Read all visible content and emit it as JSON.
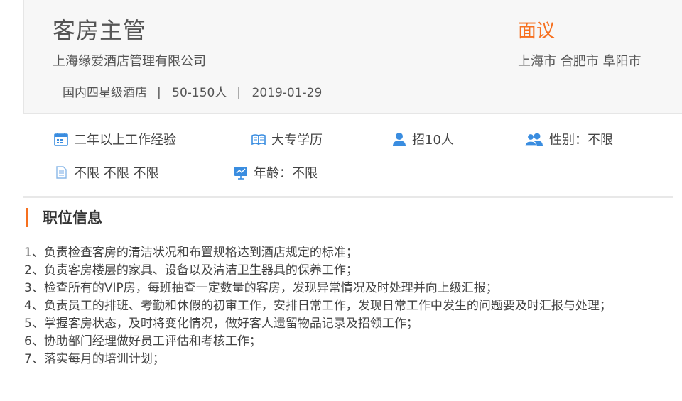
{
  "job": {
    "title": "客房主管",
    "company": "上海缘爱酒店管理有限公司",
    "hotel_type": "国内四星级酒店",
    "company_size": "50-150人",
    "post_date": "2019-01-29",
    "separator": "|",
    "salary": "面议",
    "location": "上海市 合肥市 阜阳市"
  },
  "requirements": [
    {
      "icon": "calendar-icon",
      "text": "二年以上工作经验"
    },
    {
      "icon": "book-icon",
      "text": "大专学历"
    },
    {
      "icon": "person-icon",
      "text": "招10人"
    },
    {
      "icon": "people-icon",
      "text": "性别：不限"
    },
    {
      "icon": "document-icon",
      "text": "不限 不限 不限"
    },
    {
      "icon": "presentation-icon",
      "text": "年龄：不限"
    }
  ],
  "section": {
    "title": "职位信息"
  },
  "duties": [
    "1、负责检查客房的清洁状况和布置规格达到酒店规定的标准；",
    "2、负责客房楼层的家具、设备以及清洁卫生器具的保养工作；",
    "3、检查所有的VIP房，每班抽查一定数量的客房，发现异常情况及时处理并向上级汇报；",
    "4、负责员工的排班、考勤和休假的初审工作，安排日常工作，发现日常工作中发生的问题要及时汇报与处理；",
    "5、掌握客房状态，及时将变化情况，做好客人遗留物品记录及招领工作；",
    "6、协助部门经理做好员工评估和考核工作；",
    "7、落实每月的培训计划；"
  ],
  "colors": {
    "accent": "#f6701f",
    "icon": "#3a8de0"
  }
}
